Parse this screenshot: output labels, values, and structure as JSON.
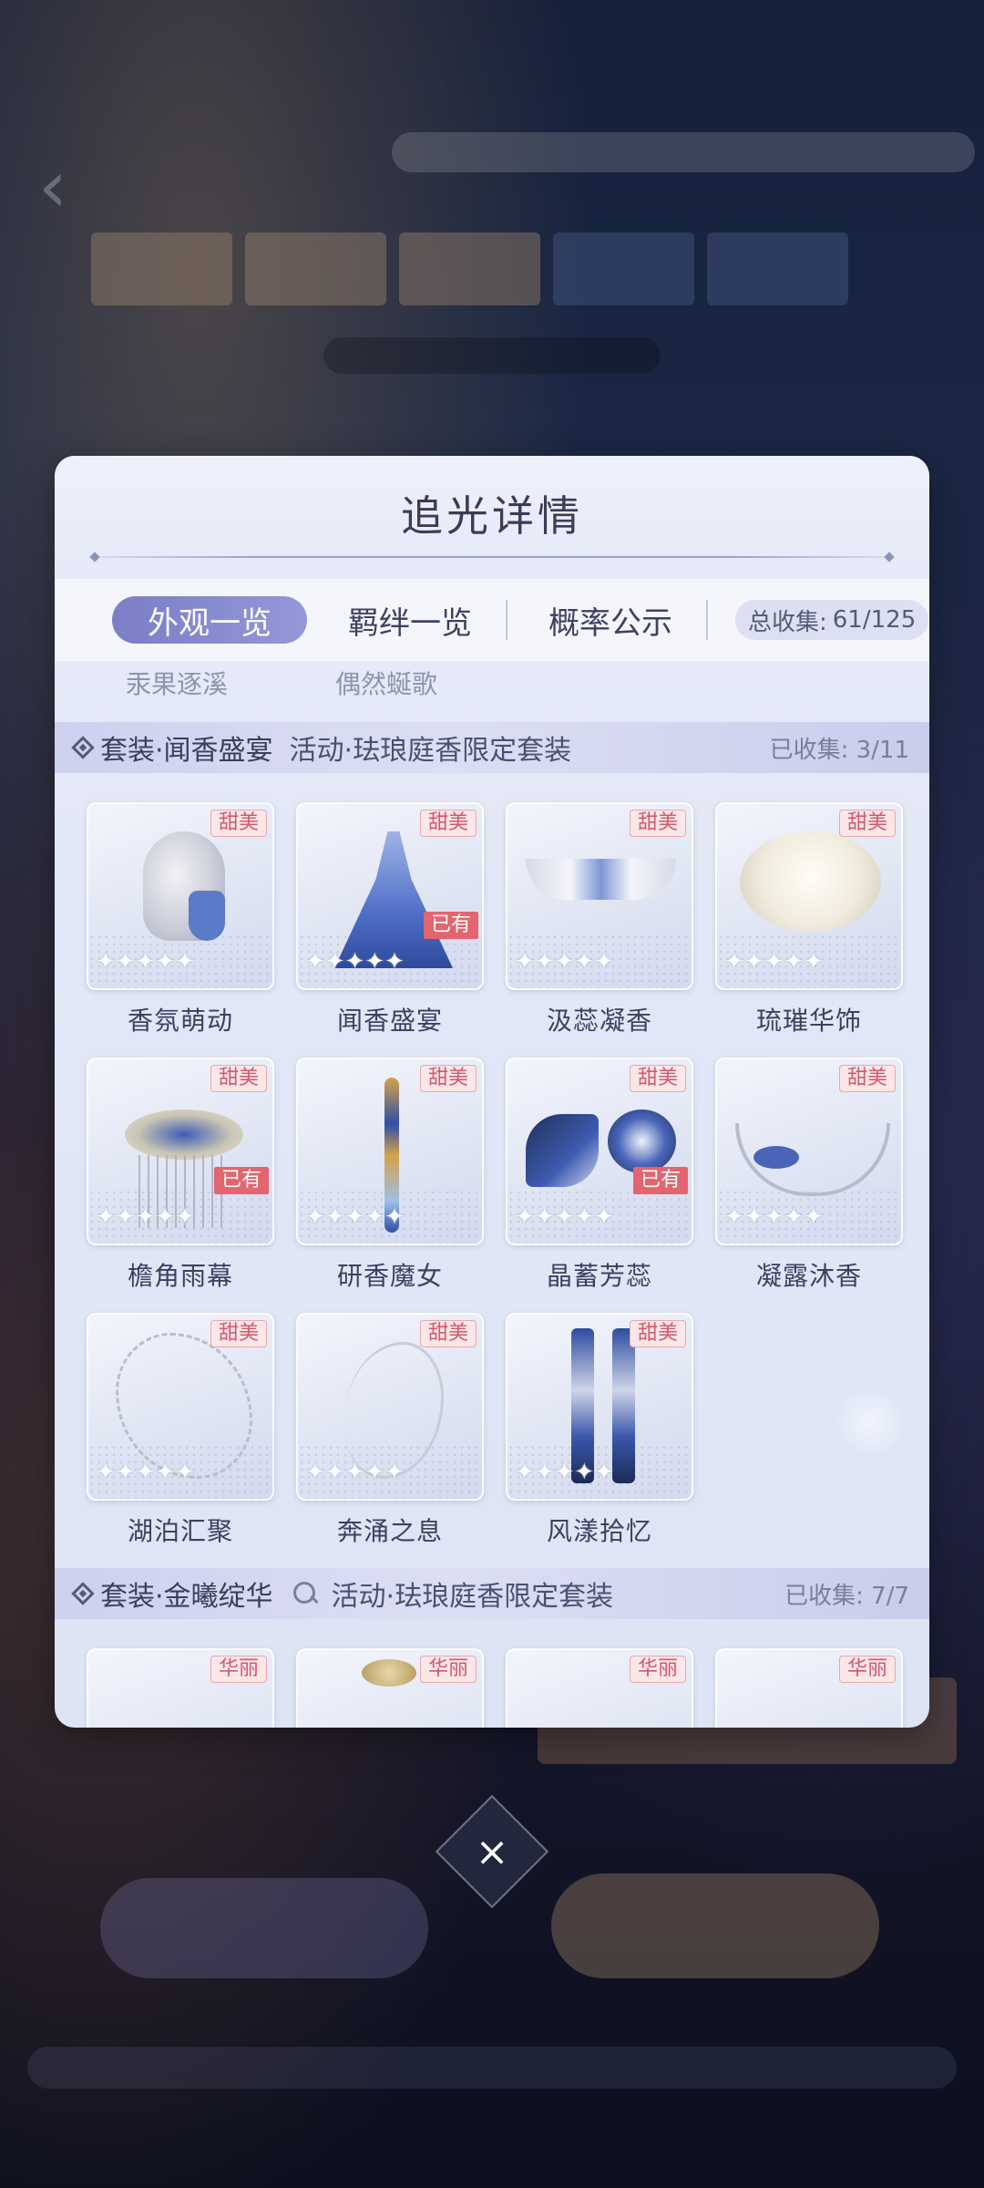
{
  "modal": {
    "title": "追光详情",
    "tabs": [
      {
        "label": "外观一览",
        "active": true
      },
      {
        "label": "羁绊一览",
        "active": false
      },
      {
        "label": "概率公示",
        "active": false
      }
    ],
    "total_label": "总收集:",
    "total_count": "61/125",
    "prev_row_items": [
      "汞果逐溪",
      "偶然蜒歌"
    ],
    "sections": [
      {
        "set_label": "套装·闻香盛宴",
        "event_label": "活动·珐琅庭香限定套装",
        "collected": "已收集: 3/11",
        "items": [
          {
            "name": "香氛萌动",
            "tag": "甜美",
            "owned": false,
            "icon": "hair-icon"
          },
          {
            "name": "闻香盛宴",
            "tag": "甜美",
            "owned": true,
            "owned_label": "已有",
            "icon": "dress-icon"
          },
          {
            "name": "汲蕊凝香",
            "tag": "甜美",
            "owned": false,
            "icon": "headpiece-icon"
          },
          {
            "name": "琉璀华饰",
            "tag": "甜美",
            "owned": false,
            "icon": "ruff-collar-icon"
          },
          {
            "name": "檐角雨幕",
            "tag": "甜美",
            "owned": true,
            "owned_label": "已有",
            "icon": "hat-icon"
          },
          {
            "name": "研香魔女",
            "tag": "甜美",
            "owned": false,
            "icon": "wand-icon"
          },
          {
            "name": "晶蓄芳蕊",
            "tag": "甜美",
            "owned": true,
            "owned_label": "已有",
            "icon": "flower-icon"
          },
          {
            "name": "凝露沐香",
            "tag": "甜美",
            "owned": false,
            "icon": "necklace-icon"
          },
          {
            "name": "湖泊汇聚",
            "tag": "甜美",
            "owned": false,
            "icon": "chain-icon"
          },
          {
            "name": "奔涌之息",
            "tag": "甜美",
            "owned": false,
            "icon": "chain-icon"
          },
          {
            "name": "风漾拾忆",
            "tag": "甜美",
            "owned": false,
            "icon": "boots-icon"
          }
        ]
      },
      {
        "set_label": "套装·金曦绽华",
        "event_label": "活动·珐琅庭香限定套装",
        "collected": "已收集: 7/7",
        "items": [
          {
            "tag": "华丽"
          },
          {
            "tag": "华丽"
          },
          {
            "tag": "华丽"
          },
          {
            "tag": "华丽"
          }
        ]
      }
    ],
    "stars": "✦✦✦✦✦",
    "close_icon": "×"
  },
  "background": {
    "back_icon": "‹"
  }
}
